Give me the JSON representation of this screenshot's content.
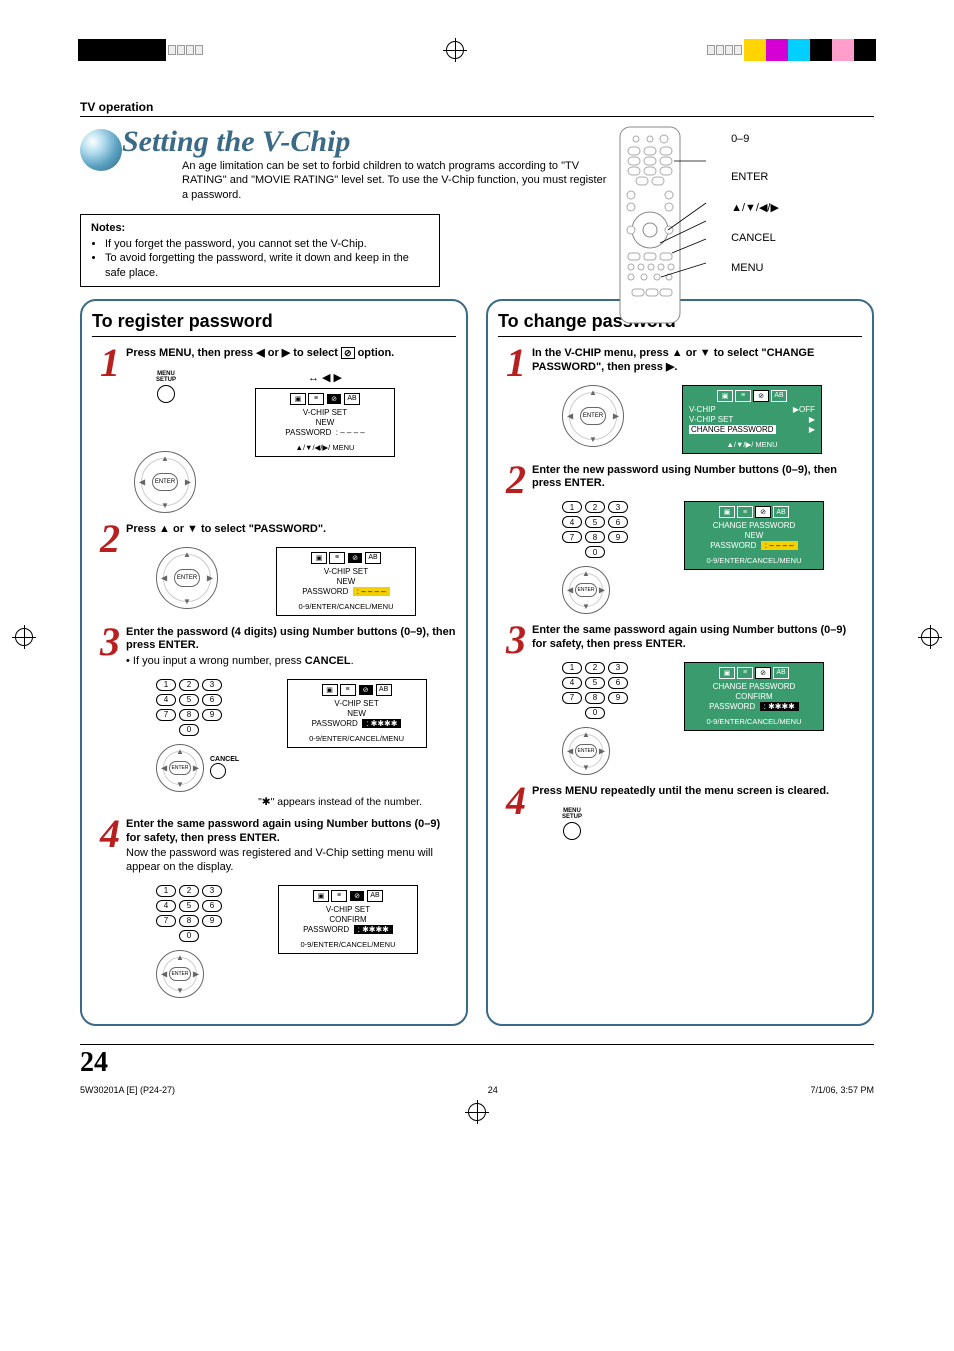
{
  "header": {
    "section": "TV operation",
    "title": "Setting the V-Chip",
    "intro": "An age limitation can be set to forbid children to watch programs according to \"TV RATING\" and \"MOVIE RATING\" level set. To use the V-Chip function, you must register a password."
  },
  "remote": {
    "labels": {
      "nums": "0–9",
      "enter": "ENTER",
      "arrows": "▲/▼/◀/▶",
      "cancel": "CANCEL",
      "menu": "MENU"
    }
  },
  "notes": {
    "heading": "Notes:",
    "items": [
      "If you forget the password, you cannot set the V-Chip.",
      "To avoid forgetting the password, write it down and keep in the safe place."
    ]
  },
  "left": {
    "heading": "To register password",
    "step1": {
      "text_a": "Press MENU, then press ◀ or ▶ to select ",
      "text_b": " option.",
      "menu_btn": "MENU\nSETUP",
      "osd": {
        "line1": "V-CHIP SET",
        "line2a": "NEW",
        "line2b": "PASSWORD",
        "dash": ": – – – –",
        "foot": "▲/▼/◀/▶/ MENU"
      }
    },
    "step2": {
      "text": "Press ▲ or ▼ to select \"PASSWORD\".",
      "osd": {
        "line1": "V-CHIP SET",
        "line2a": "NEW",
        "line2b": "PASSWORD",
        "dash": ": – – – –",
        "foot": "0-9/ENTER/CANCEL/MENU"
      }
    },
    "step3": {
      "text": "Enter the password (4 digits) using Number buttons (0–9), then press ENTER.",
      "sub": "• If you input a wrong number, press CANCEL.",
      "cancel": "CANCEL",
      "osd": {
        "line1": "V-CHIP  SET",
        "line2a": "NEW",
        "line2b": "PASSWORD",
        "stars": ": ✱✱✱✱",
        "foot": "0-9/ENTER/CANCEL/MENU"
      },
      "note": "\"✱\" appears instead of the number."
    },
    "step4": {
      "text": "Enter the same password again using Number buttons (0–9) for safety, then press ENTER.",
      "sub": "Now the password was registered and V-Chip setting menu will appear on the display.",
      "osd": {
        "line1": "V-CHIP  SET",
        "line2a": "CONFIRM",
        "line2b": "PASSWORD",
        "stars": ": ✱✱✱✱",
        "foot": "0-9/ENTER/CANCEL/MENU"
      }
    }
  },
  "right": {
    "heading": "To change password",
    "step1": {
      "text": "In the V-CHIP menu, press ▲ or ▼ to select \"CHANGE PASSWORD\", then press ▶.",
      "osd": {
        "l1": "V-CHIP",
        "l1v": "▶OFF",
        "l2": "V-CHIP SET",
        "l2v": "▶",
        "l3": "CHANGE PASSWORD",
        "l3v": "▶",
        "foot": "▲/▼/▶/ MENU"
      }
    },
    "step2": {
      "text": "Enter the new password using Number buttons (0–9), then press ENTER.",
      "osd": {
        "line1": "CHANGE  PASSWORD",
        "line2a": "NEW",
        "line2b": "PASSWORD",
        "dash": ": – – – –",
        "foot": "0-9/ENTER/CANCEL/MENU"
      }
    },
    "step3": {
      "text": "Enter the same password again using Number buttons (0–9) for safety, then press ENTER.",
      "osd": {
        "line1": "CHANGE  PASSWORD",
        "line2a": "CONFIRM",
        "line2b": "PASSWORD",
        "stars": ": ✱✱✱✱",
        "foot": "0-9/ENTER/CANCEL/MENU"
      }
    },
    "step4": {
      "text": "Press MENU repeatedly until the menu screen is cleared.",
      "menu_btn": "MENU\nSETUP"
    }
  },
  "numbers": [
    "1",
    "2",
    "3",
    "4",
    "5",
    "6",
    "7",
    "8",
    "9",
    "0"
  ],
  "page": {
    "number": "24",
    "footer_left": "5W30201A [E] (P24-27)",
    "footer_center": "24",
    "footer_right": "7/1/06, 3:57 PM"
  },
  "glyphs": {
    "up": "▲",
    "down": "▼",
    "left": "◀",
    "right": "▶",
    "enter": "ENTER"
  }
}
